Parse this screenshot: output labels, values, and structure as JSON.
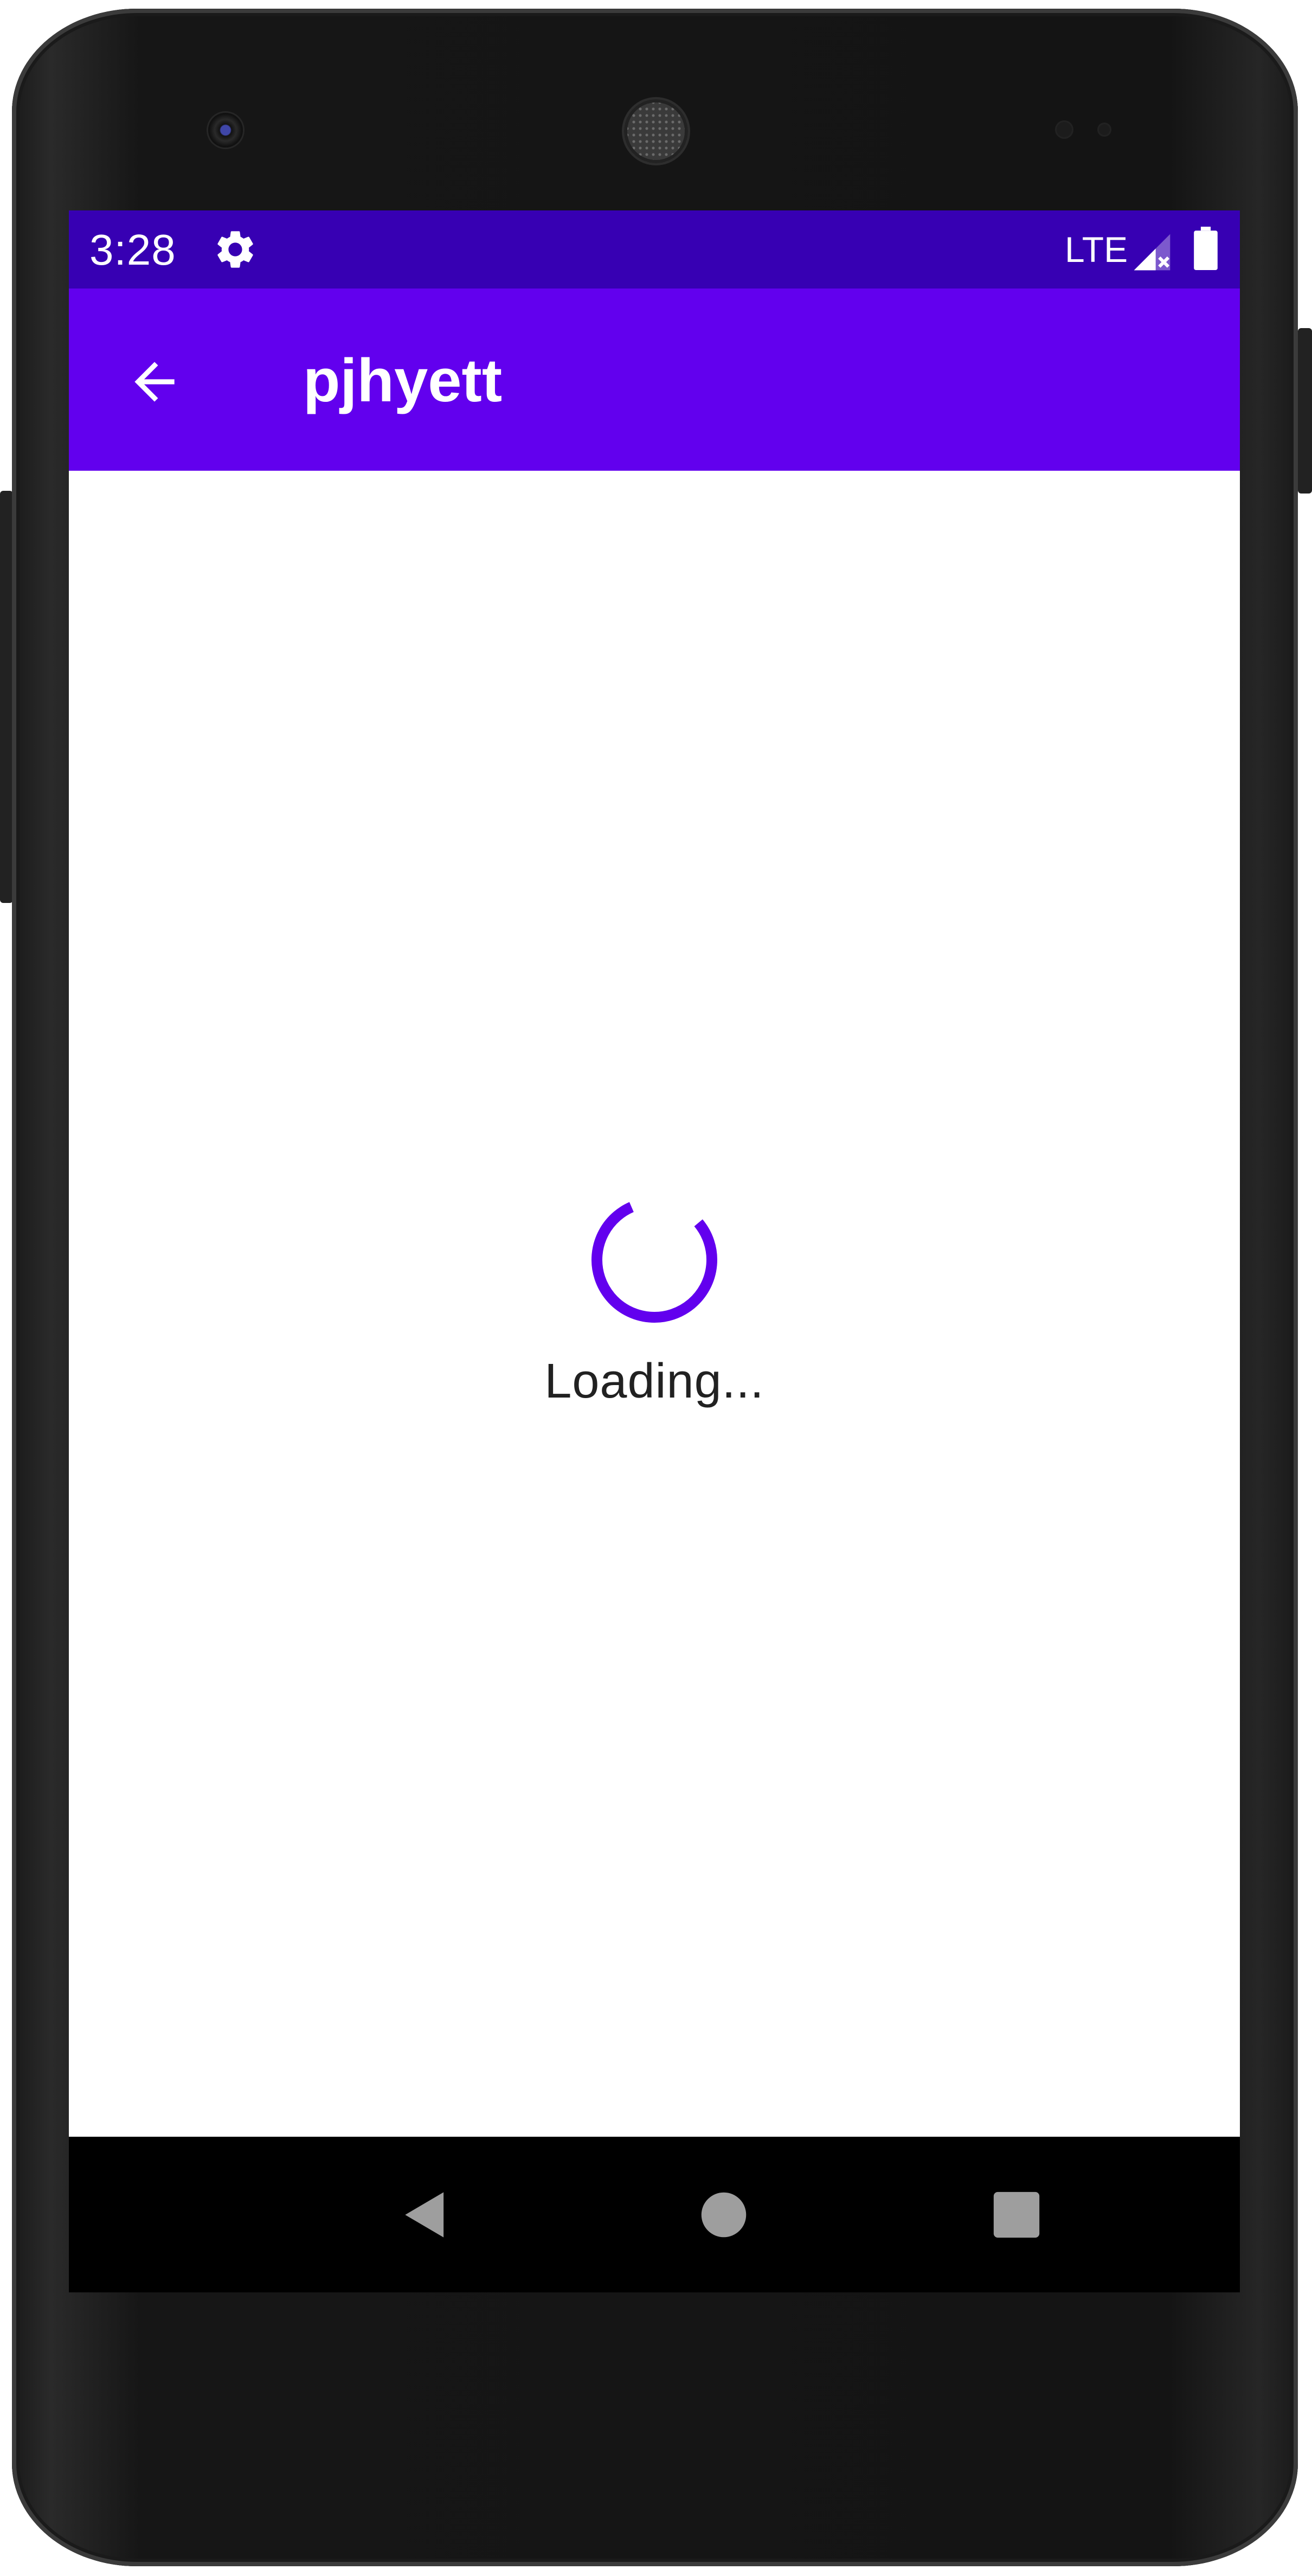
{
  "status_bar": {
    "time": "3:28",
    "network": "LTE",
    "icons": [
      "gear-icon",
      "signal-icon",
      "battery-icon"
    ]
  },
  "app_bar": {
    "title": "pjhyett",
    "back_icon": "arrow-left-icon"
  },
  "content": {
    "loading_text": "Loading..."
  },
  "nav_bar": {
    "buttons": [
      "back-triangle-icon",
      "home-circle-icon",
      "recents-square-icon"
    ]
  },
  "colors": {
    "status_bar": "#3700b3",
    "app_bar": "#6200ee",
    "spinner": "#6200ee",
    "nav_bar": "#000000",
    "nav_icons": "#9e9e9e"
  }
}
